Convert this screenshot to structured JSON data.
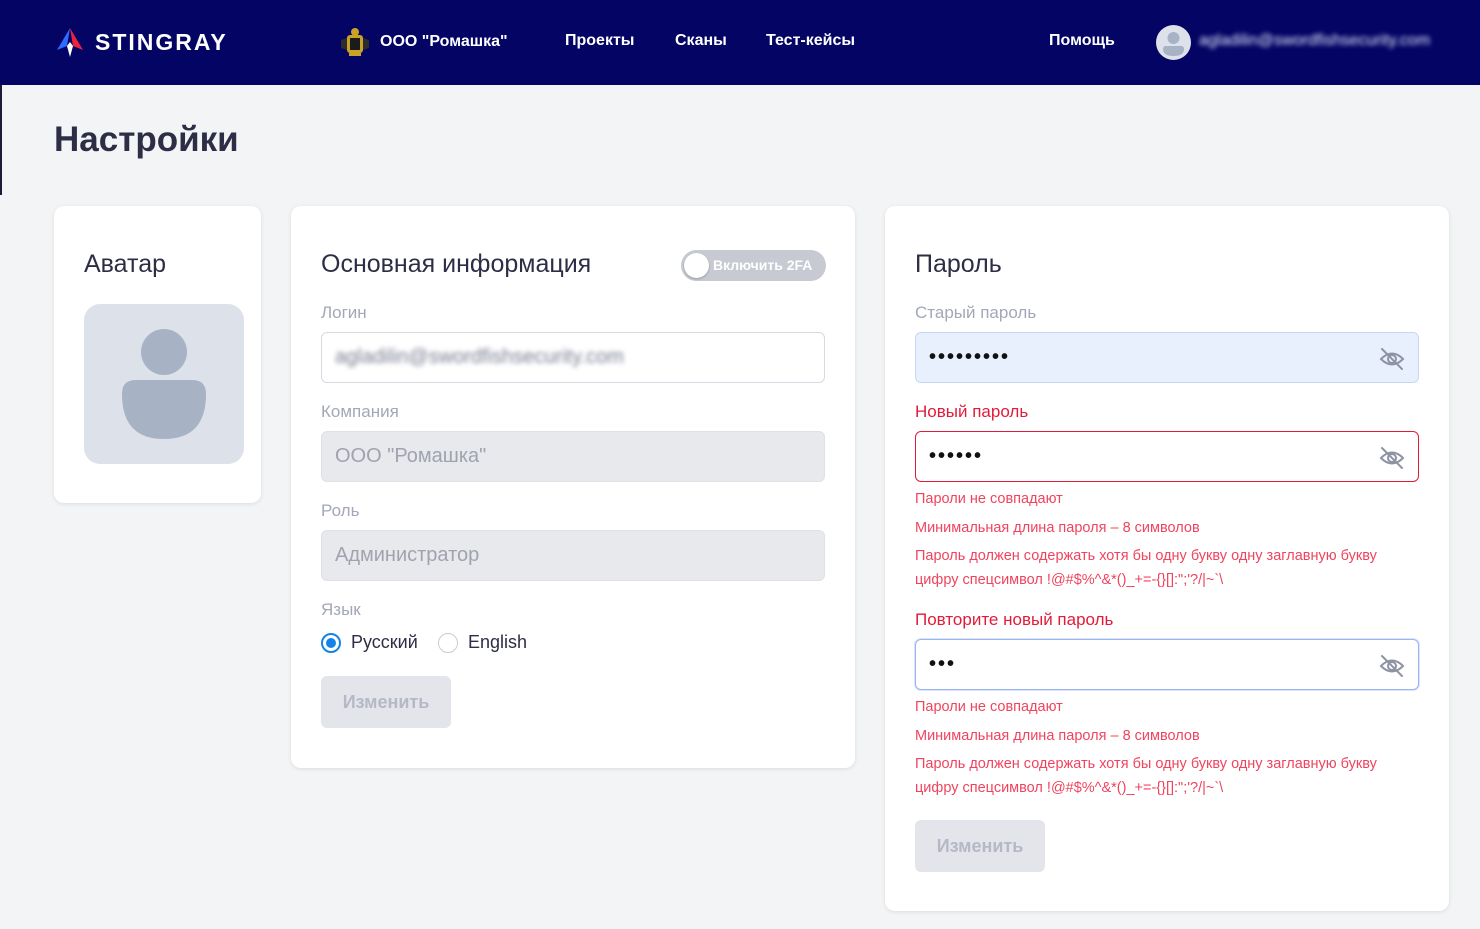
{
  "header": {
    "brand": "STINGRAY",
    "org_name": "ООО \"Ромашка\"",
    "nav": [
      "Проекты",
      "Сканы",
      "Тест-кейсы"
    ],
    "help": "Помощь",
    "user_email": "agladilin@swordfishsecurity.com"
  },
  "page": {
    "title": "Настройки"
  },
  "avatar_card": {
    "title": "Аватар"
  },
  "info_card": {
    "title": "Основная информация",
    "toggle_2fa_label": "Включить 2FA",
    "toggle_2fa_on": false,
    "login_label": "Логин",
    "login_value": "agladilin@swordfishsecurity.com",
    "company_label": "Компания",
    "company_value": "ООО \"Ромашка\"",
    "role_label": "Роль",
    "role_value": "Администратор",
    "language_label": "Язык",
    "language_options": [
      "Русский",
      "English"
    ],
    "language_selected": "Русский",
    "submit": "Изменить"
  },
  "password_card": {
    "title": "Пароль",
    "old_label": "Старый пароль",
    "old_value": "•••••••••",
    "new_label": "Новый пароль",
    "new_value": "••••••",
    "new_errors": [
      "Пароли не совпадают",
      "Минимальная длина пароля – 8 символов",
      "Пароль должен содержать хотя бы одну букву одну заглавную букву цифру спецсимвол !@#$%^&*()_+=-{}[]:\";'?/|~`\\"
    ],
    "repeat_label": "Повторите новый пароль",
    "repeat_value": "•••",
    "repeat_errors": [
      "Пароли не совпадают",
      "Минимальная длина пароля – 8 символов",
      "Пароль должен содержать хотя бы одну букву одну заглавную букву цифру спецсимвол !@#$%^&*()_+=-{}[]:\";'?/|~`\\"
    ],
    "submit": "Изменить"
  },
  "colors": {
    "header_bg": "#030464",
    "error": "#e31b3a",
    "radio_accent": "#1483e8",
    "autofill_bg": "#e8f0fe"
  }
}
